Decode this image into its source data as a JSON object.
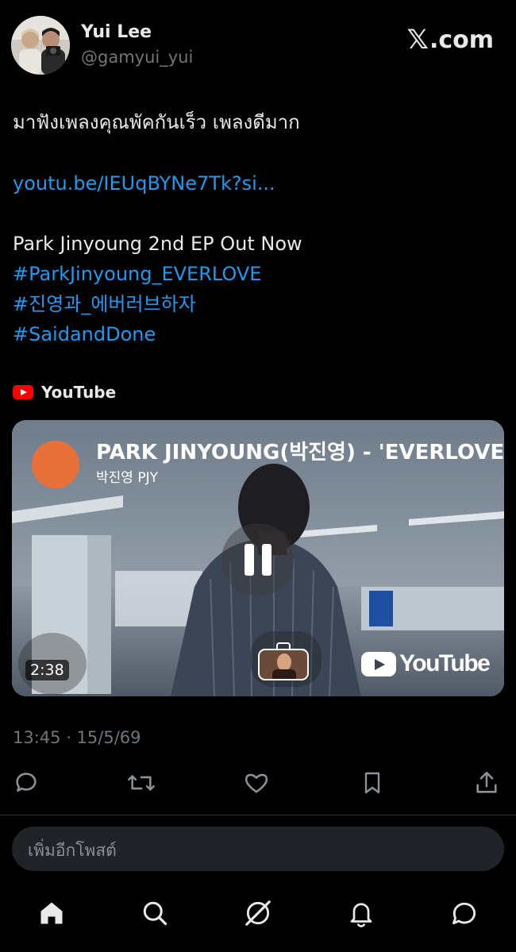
{
  "header": {
    "display_name": "Yui Lee",
    "handle": "@gamyui_yui",
    "brand_mark": "𝕏",
    "brand_suffix": ".com"
  },
  "tweet": {
    "text_line1": "มาฟังเพลงคุณพัคกันเร็ว เพลงดีมาก",
    "link": "youtu.be/IEUqBYNe7Tk?si...",
    "text_line2": "Park Jinyoung 2nd EP Out Now",
    "hashtags": [
      "#ParkJinyoung_EVERLOVE",
      "#진영과_에버러브하자",
      "#SaidandDone"
    ],
    "timestamp": "13:45 · 15/5/69"
  },
  "card": {
    "source_label": "YouTube",
    "video_title": "PARK JINYOUNG(박진영) - 'EVERLOVE",
    "channel_name": "박진영 PJY",
    "duration": "2:38",
    "wordmark": "YouTube"
  },
  "reply": {
    "placeholder": "เพิ่มอีกโพสต์"
  },
  "icons": {
    "reply": "reply-icon",
    "repost": "repost-icon",
    "like": "heart-icon",
    "bookmark": "bookmark-icon",
    "share": "share-icon",
    "nav": [
      "home-icon",
      "search-icon",
      "grok-icon",
      "notifications-icon",
      "messages-icon"
    ]
  },
  "colors": {
    "background": "#000000",
    "link": "#1d9bf0",
    "muted": "#71767b",
    "youtube_red": "#ff0000",
    "channel_avatar": "#e8713a"
  }
}
